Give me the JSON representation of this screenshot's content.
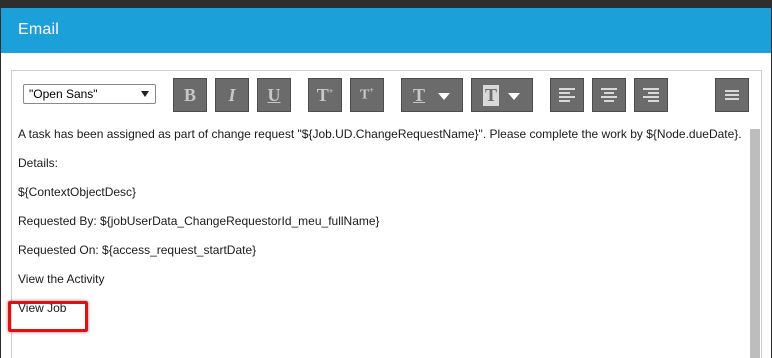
{
  "dialog": {
    "title": "Email"
  },
  "toolbar": {
    "font_family": "\"Open Sans\"",
    "bold_label": "B",
    "italic_label": "I",
    "underline_label": "U",
    "superscript_label": "T",
    "subscript_label": "T",
    "text_color_label": "T",
    "highlight_color_label": "T",
    "icons": [
      "chevron-down-icon",
      "bold-icon",
      "italic-icon",
      "underline-icon",
      "superscript-icon",
      "subscript-icon",
      "text-color-icon",
      "highlight-color-icon",
      "align-left-icon",
      "align-center-icon",
      "align-right-icon",
      "menu-icon"
    ]
  },
  "content": {
    "line1": "A task has been assigned as part of change request \"${Job.UD.ChangeRequestName}\". Please complete the work by ${Node.dueDate}.",
    "details": "Details:",
    "context": "${ContextObjectDesc}",
    "requested_by": "Requested By: ${jobUserData_ChangeRequestorId_meu_fullName}",
    "requested_on": "Requested On: ${access_request_startDate}",
    "view_activity": "View the Activity",
    "view_job": "View Job"
  },
  "colors": {
    "accent": "#1ba0d9",
    "highlight_box": "#dd1111",
    "toolbar_button": "#6b6b6b"
  }
}
